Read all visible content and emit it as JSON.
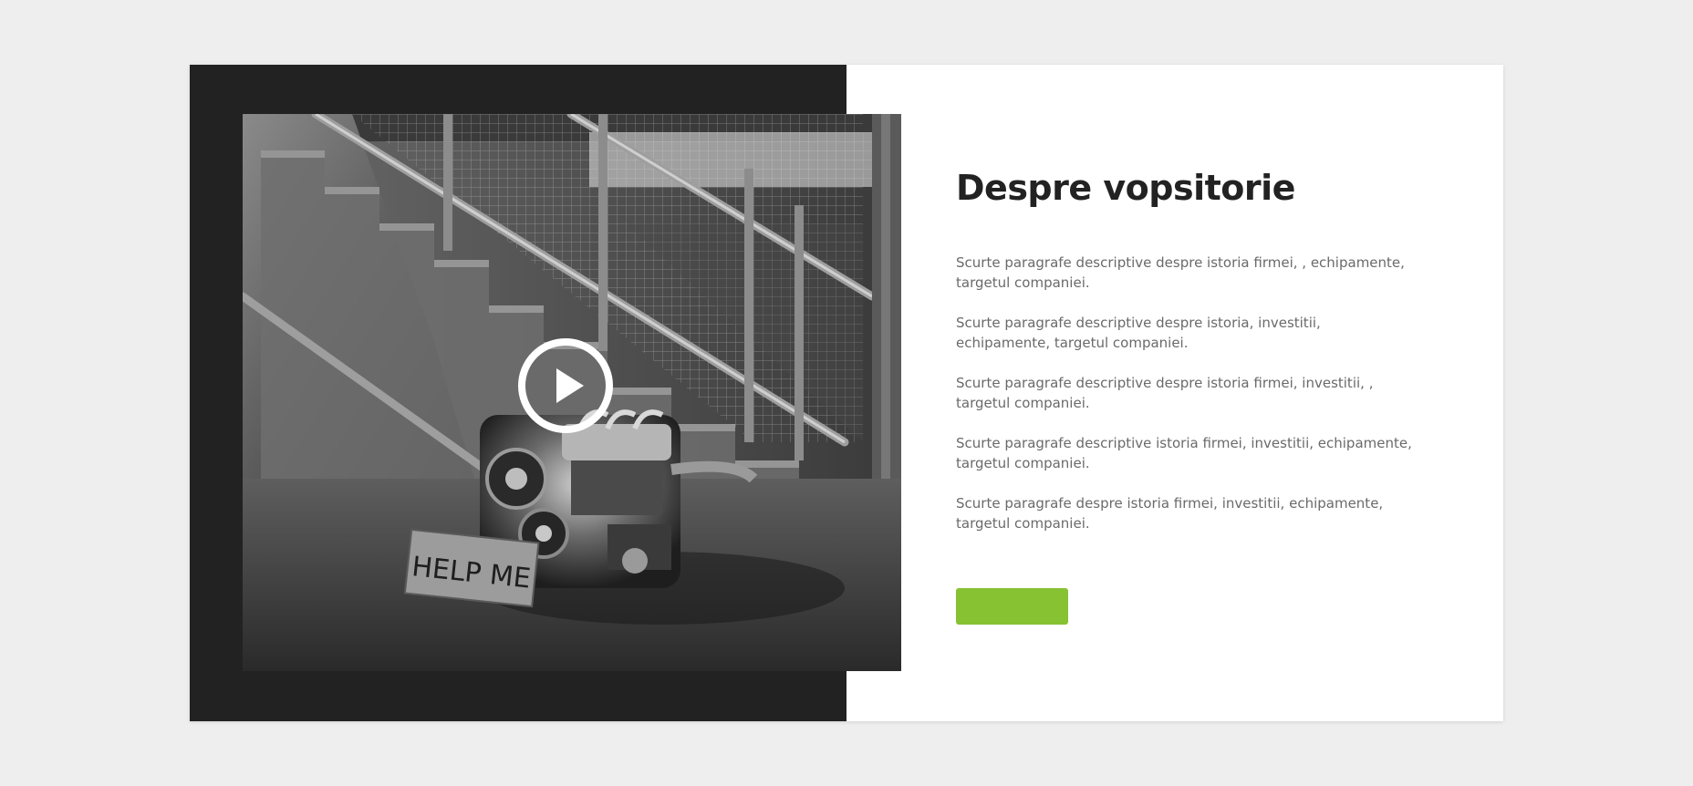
{
  "section": {
    "title": "Despre vopsitorie",
    "paragraphs": [
      "Scurte paragrafe descriptive despre istoria firmei, , echipamente, targetul companiei.",
      "Scurte paragrafe descriptive despre istoria, investitii, echipamente, targetul companiei.",
      "Scurte paragrafe descriptive despre istoria firmei, investitii, , targetul companiei.",
      "Scurte paragrafe descriptive istoria firmei, investitii, echipamente, targetul companiei.",
      "Scurte paragrafe despre istoria firmei, investitii, echipamente, targetul companiei."
    ],
    "button_label": ""
  },
  "media": {
    "sign_text": "HELP ME",
    "play_icon": "play-icon"
  },
  "colors": {
    "accent": "#86c232",
    "dark_panel": "#222222",
    "title": "#222222",
    "body_text": "#6a6a6a",
    "background": "#eeeeee"
  }
}
